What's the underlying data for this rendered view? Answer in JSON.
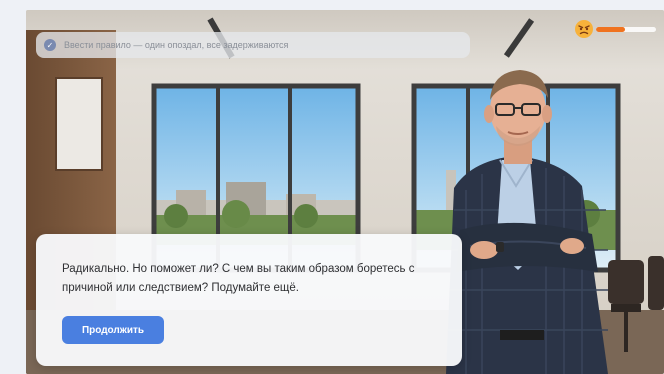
{
  "choice": {
    "badge": "✓",
    "text": "Ввести правило — один опоздал, все задерживаются"
  },
  "mood": {
    "icon": "angry-face-icon",
    "level_percent": 48,
    "fill_color": "#f0731f"
  },
  "dialog": {
    "text": "Радикально. Но поможет ли? С чем вы таким образом боретесь с причиной или следствием? Подумайте ещё.",
    "continue_label": "Продолжить",
    "accent": "#4a7fe0"
  },
  "scene": {
    "setting": "office-background",
    "character": "manager-character"
  }
}
